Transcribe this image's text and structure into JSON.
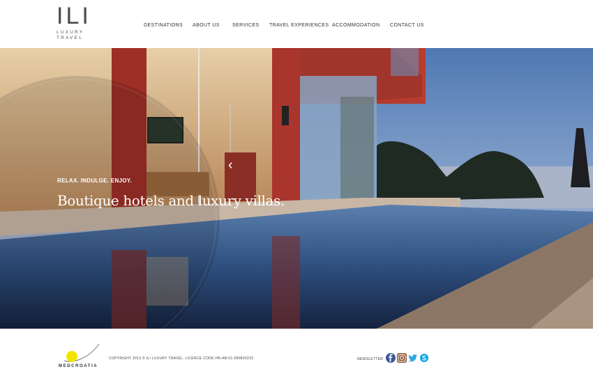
{
  "header": {
    "logo": {
      "mark": "ILI",
      "line1": "LUXURY",
      "line2": "TRAVEL"
    },
    "nav": [
      {
        "label": "Destinations",
        "name": "nav-destinations"
      },
      {
        "label": "ABOUT US",
        "name": "nav-about-us"
      },
      {
        "label": "SERVICES",
        "name": "nav-services"
      },
      {
        "label": "TRAVEL EXPERIENCES",
        "name": "nav-travel-experiences"
      },
      {
        "label": "ACCOMMODATION",
        "name": "nav-accommodation"
      },
      {
        "label": "CONTACT US",
        "name": "nav-contact-us"
      }
    ]
  },
  "hero": {
    "tagline": "RELAX. INDULGE. ENJOY.",
    "headline": "Boutique hotels and luxury villas.",
    "arrow_icon": "chevron-left-icon"
  },
  "footer": {
    "partner_logo_text": "MEDCROATIA",
    "copyright": "COPYRIGHT 2013 © ILI LUXURY TRAVEL. LICENCE CODE HR-AB-01-080830233",
    "newsletter": "NEWSLETTER",
    "social": [
      {
        "icon": "facebook-icon",
        "color": "#3b5998"
      },
      {
        "icon": "instagram-icon",
        "color": "#8a5a3c"
      },
      {
        "icon": "twitter-icon",
        "color": "#2fa9e0"
      },
      {
        "icon": "skype-icon",
        "color": "#12a5e8"
      }
    ]
  },
  "colors": {
    "accent_yellow": "#f2e600",
    "wall_red": "#a8322a",
    "sky_blue": "#6f94c2"
  }
}
